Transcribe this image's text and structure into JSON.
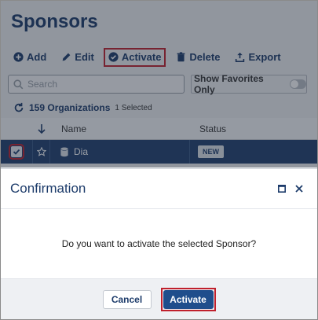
{
  "page_title": "Sponsors",
  "toolbar": {
    "add_label": "Add",
    "edit_label": "Edit",
    "activate_label": "Activate",
    "delete_label": "Delete",
    "export_label": "Export"
  },
  "search": {
    "placeholder": "Search",
    "favorites_label": "Show Favorites Only"
  },
  "summary": {
    "count_label": "159 Organizations",
    "selected_label": "1 Selected"
  },
  "table": {
    "columns": [
      "Name",
      "Status"
    ],
    "rows": [
      {
        "name": "Dia",
        "status": "NEW",
        "selected": true
      }
    ]
  },
  "dialog": {
    "title": "Confirmation",
    "message": "Do you want to activate the selected Sponsor?",
    "cancel_label": "Cancel",
    "activate_label": "Activate"
  },
  "colors": {
    "primary": "#1c3b6a",
    "selected_row": "#1f3f6e",
    "primary_button": "#1f4e8c",
    "highlight": "#c0202c"
  }
}
